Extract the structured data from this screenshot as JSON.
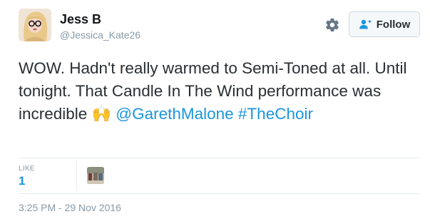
{
  "user": {
    "name": "Jess B",
    "handle": "@Jessica_Kate26"
  },
  "actions": {
    "follow_label": "Follow"
  },
  "tweet": {
    "text_part1": "WOW. Hadn't really warmed to Semi-Toned at all. Until tonight. That Candle In The Wind performance was incredible ",
    "emoji": "🙌",
    "mention": "@GarethMalone",
    "hashtag": "#TheChoir"
  },
  "stats": {
    "likes_label": "LIKE",
    "likes_count": "1"
  },
  "timestamp": "3:25 PM - 29 Nov 2016",
  "colors": {
    "link": "#1b95e0",
    "text": "#292f33",
    "muted": "#8899a6",
    "border": "#e6ecf0",
    "button_bg": "#f5f8fa"
  },
  "icons": {
    "settings": "gear-icon",
    "follow": "add-person-icon"
  }
}
